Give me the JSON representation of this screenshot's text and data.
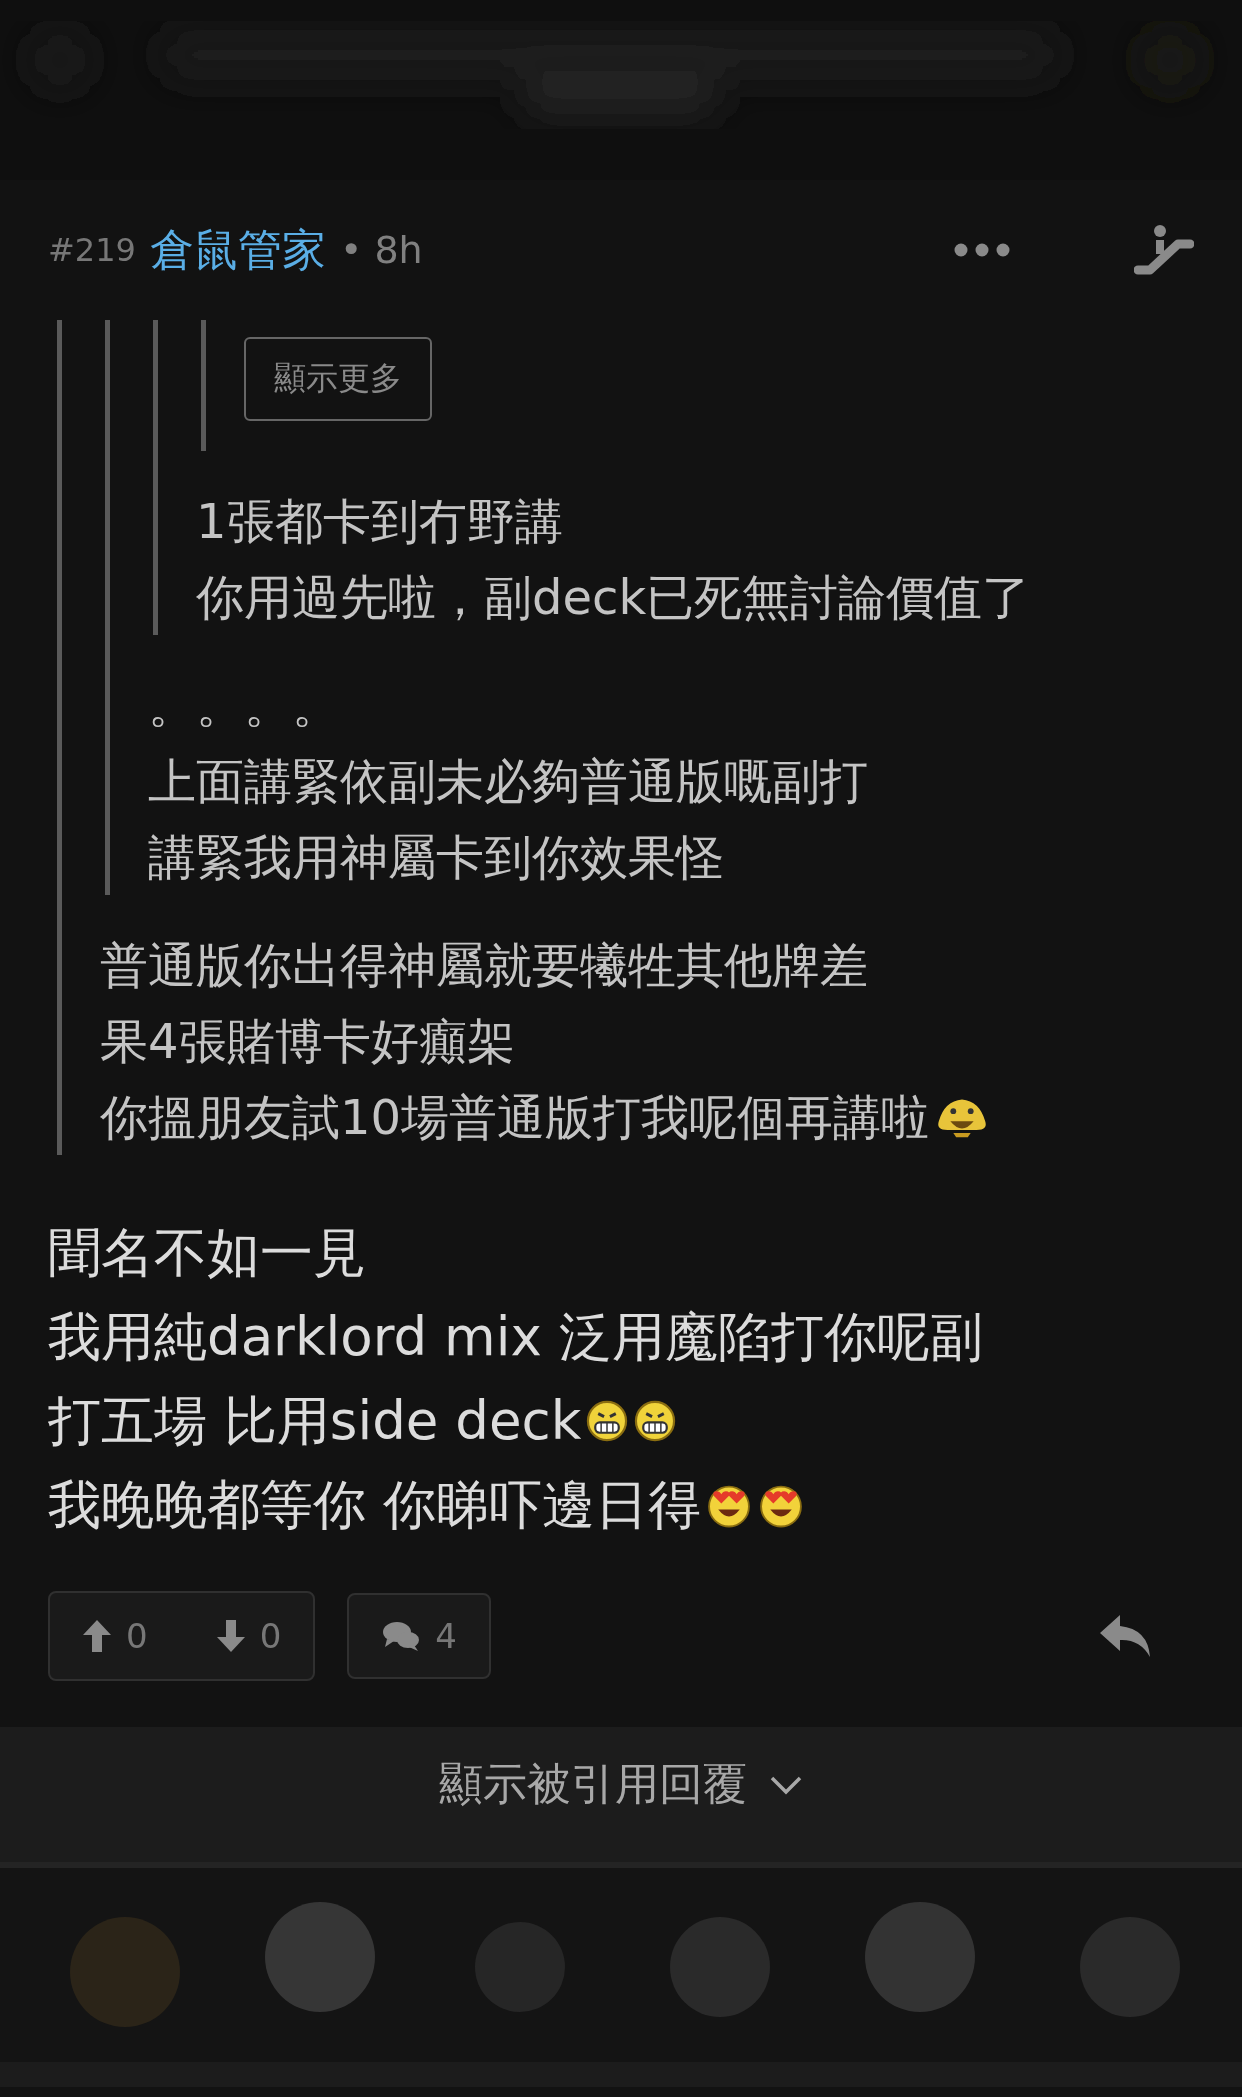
{
  "post": {
    "number": "#219",
    "author": "倉鼠管家",
    "separator": "•",
    "age": "8h"
  },
  "quote": {
    "quote": {
      "quote": {
        "quote": {
          "more_button": "顯示更多"
        },
        "lines": [
          {
            "text": "1張都卡到冇野講"
          },
          {
            "text": "你用過先啦，副deck已死無討論價值了"
          }
        ]
      },
      "lines": [
        {
          "text": "。。。。"
        },
        {
          "text": "上面講緊依副未必夠普通版嘅副打"
        },
        {
          "text": "講緊我用神屬卡到你效果怪"
        }
      ]
    },
    "lines": [
      {
        "text": "普通版你出得神屬就要犧牲其他牌差"
      },
      {
        "text": "果4張賭博卡好癲架"
      },
      {
        "text": "你搵朋友試10場普通版打我呢個再講啦",
        "emoji": [
          {
            "kind": "duck"
          }
        ]
      }
    ]
  },
  "body": [
    {
      "text": "聞名不如一見"
    },
    {
      "text": "我用純darklord mix 泛用魔陷打你呢副"
    },
    {
      "text": "打五場 比用side deck",
      "emoji": [
        {
          "kind": "grin"
        },
        {
          "kind": "grin"
        }
      ]
    },
    {
      "text": "我晚晚都等你 你睇吓邊日得",
      "emoji": [
        {
          "kind": "heart-eyes"
        },
        {
          "kind": "heart-eyes"
        }
      ]
    }
  ],
  "actions": {
    "upvotes": "0",
    "downvotes": "0",
    "comments": "4"
  },
  "quoted_replies_button": "顯示被引用回覆"
}
